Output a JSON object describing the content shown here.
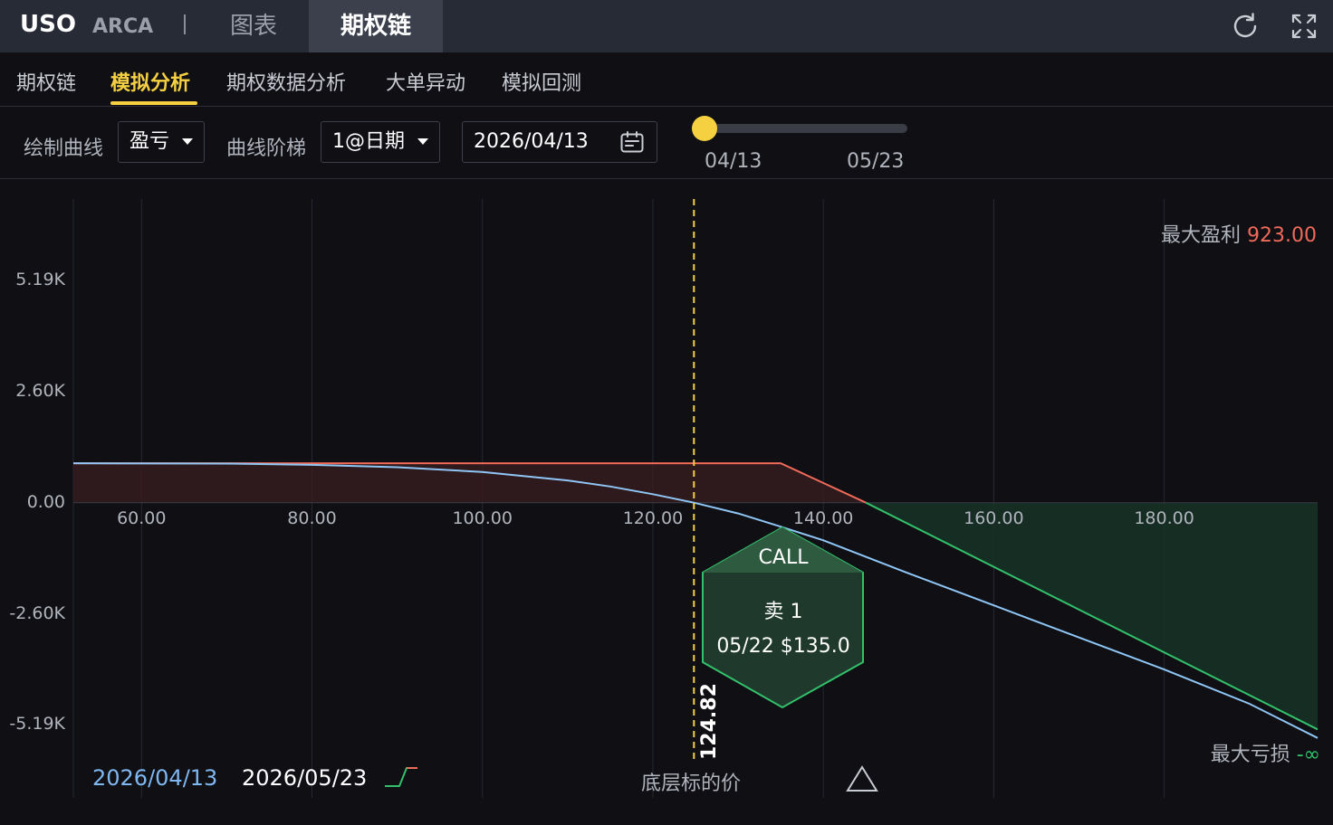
{
  "header": {
    "ticker": "USO",
    "exchange": "ARCA",
    "tabs": [
      "图表",
      "期权链"
    ],
    "active_tab": "期权链"
  },
  "subnav": {
    "tabs": [
      "期权链",
      "模拟分析",
      "期权数据分析",
      "大单异动",
      "模拟回测"
    ],
    "active": "模拟分析"
  },
  "controls": {
    "curve_label": "绘制曲线",
    "curve_value": "盈亏",
    "step_label": "曲线阶梯",
    "step_value": "1@日期",
    "date_value": "2026/04/13",
    "slider_start": "04/13",
    "slider_end": "05/23",
    "slider_position": 0
  },
  "chart": {
    "max_profit_label": "最大盈利",
    "max_profit_value": "923.00",
    "max_loss_label": "最大亏损",
    "max_loss_value": "-∞",
    "current_price": "124.82",
    "underlying_label": "底层标的价",
    "legend_date_today": "2026/04/13",
    "legend_date_expiry": "2026/05/23",
    "position": {
      "type": "CALL",
      "action": "卖 1",
      "detail": "05/22 $135.0"
    },
    "colors": {
      "expiry_curve": "#f06a5a",
      "today_curve": "#8fc6f5",
      "loss_line": "#33c06b",
      "price_line": "#f5d142"
    }
  },
  "chart_data": {
    "type": "line",
    "xlabel": "",
    "ylabel": "",
    "x_ticks": [
      "60.00",
      "80.00",
      "100.00",
      "120.00",
      "140.00",
      "160.00",
      "180.00"
    ],
    "y_ticks": [
      "5.19K",
      "2.60K",
      "0.00",
      "-2.60K",
      "-5.19K"
    ],
    "xlim": [
      52,
      198
    ],
    "ylim": [
      -6900,
      7100
    ],
    "vertical_marker": 124.82,
    "series": [
      {
        "name": "2026/05/23",
        "x": [
          52,
          135,
          145,
          198
        ],
        "y": [
          923,
          923,
          0,
          -5300
        ]
      },
      {
        "name": "2026/04/13",
        "x": [
          52,
          70,
          80,
          90,
          100,
          110,
          115,
          120,
          124.82,
          130,
          135,
          140,
          150,
          160,
          170,
          180,
          190,
          198
        ],
        "y": [
          923,
          915,
          885,
          830,
          720,
          520,
          380,
          200,
          0,
          -250,
          -560,
          -880,
          -1650,
          -2400,
          -3150,
          -3900,
          -4700,
          -5500
        ]
      }
    ]
  }
}
